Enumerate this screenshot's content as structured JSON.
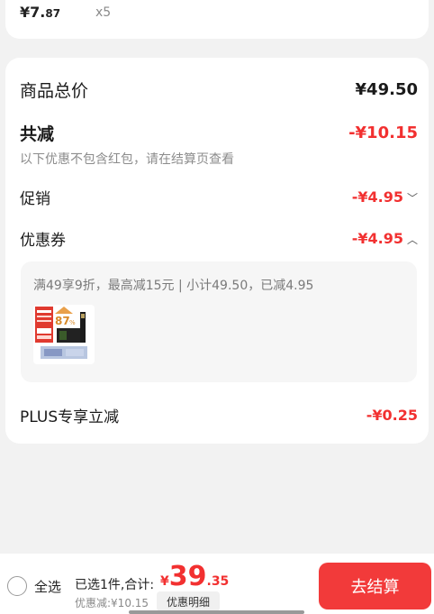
{
  "top_item": {
    "price_int": "¥7.",
    "price_dec": "87",
    "qty": "x5"
  },
  "summary": {
    "goods_total_label": "商品总价",
    "goods_total_value": "¥49.50",
    "total_reduce_label": "共减",
    "total_reduce_value": "-¥10.15",
    "note": "以下优惠不包含红包，请在结算页查看",
    "promo_label": "促销",
    "promo_value": "-¥4.95",
    "coupon_label": "优惠券",
    "coupon_value": "-¥4.95",
    "coupon_detail": "满49享9折，最高减15元 | 小计49.50，已减4.95",
    "plus_label": "PLUS专享立减",
    "plus_value": "-¥0.25"
  },
  "bottom_bar": {
    "select_all": "全选",
    "selected_count": "已选1件,合计:",
    "total_currency": "¥",
    "total_int": "39",
    "total_dec": ".35",
    "discount_text": "优惠减:¥10.15",
    "detail_button": "优惠明细",
    "checkout_button": "去结算"
  },
  "colors": {
    "accent": "#f23a3a",
    "price_red": "#f23030",
    "background": "#f2f2f2"
  },
  "icons": {
    "promo_toggle": "chevron-down-icon",
    "coupon_toggle": "chevron-up-icon",
    "radio": "radio-unchecked-icon"
  }
}
